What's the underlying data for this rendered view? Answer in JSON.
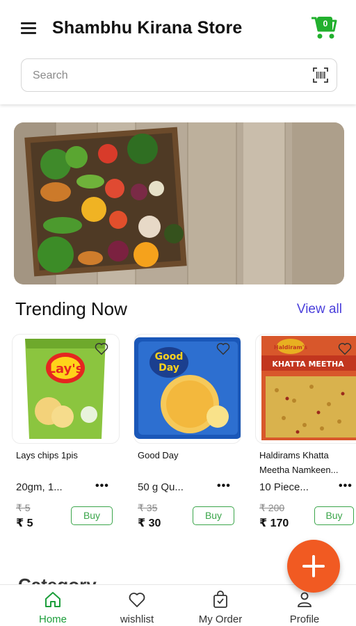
{
  "header": {
    "title": "Shambhu Kirana Store",
    "cart_count": "0",
    "cart_color": "#22b02e"
  },
  "search": {
    "placeholder": "Search",
    "value": ""
  },
  "banner": {
    "image": "vegetables-crate-on-wooden-table"
  },
  "trending": {
    "title": "Trending Now",
    "view_all": "View all",
    "products": [
      {
        "name": "Lays chips 1pis",
        "qty": "20gm, 1...",
        "mrp": "₹ 5",
        "price": "₹ 5",
        "buy": "Buy"
      },
      {
        "name": "Good Day",
        "qty": "50 g Qu...",
        "mrp": "₹ 35",
        "price": "₹ 30",
        "buy": "Buy"
      },
      {
        "name": "Haldirams Khatta Meetha Namkeen...",
        "qty": "10 Piece...",
        "mrp": "₹ 200",
        "price": "₹ 170",
        "buy": "Buy"
      }
    ]
  },
  "category_peek": "Category",
  "bottom_nav": [
    {
      "label": "Home",
      "icon": "home-icon",
      "active": true
    },
    {
      "label": "wishlist",
      "icon": "heart-icon",
      "active": false
    },
    {
      "label": "My Order",
      "icon": "order-bag-icon",
      "active": false
    },
    {
      "label": "Profile",
      "icon": "person-icon",
      "active": false
    }
  ],
  "colors": {
    "accent_green": "#1c9e3b",
    "fab_orange": "#f15a22",
    "link_purple": "#4a3fdb"
  }
}
